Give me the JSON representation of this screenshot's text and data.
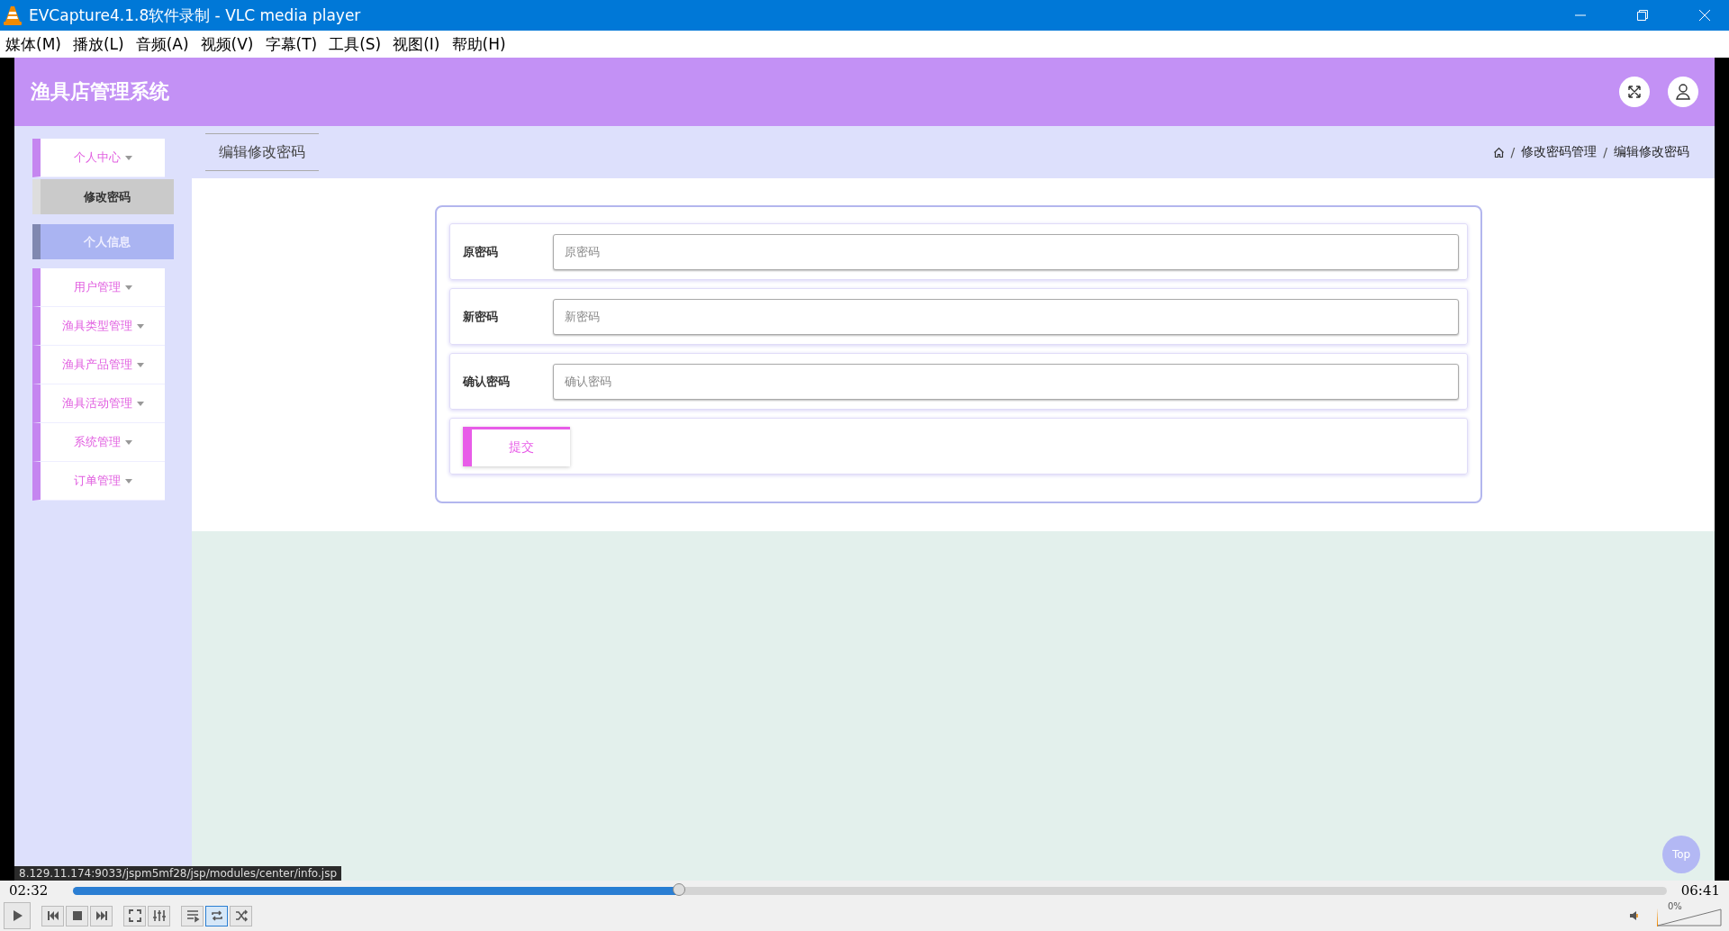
{
  "window": {
    "title": "EVCapture4.1.8软件录制 - VLC media player"
  },
  "menu": [
    "媒体(M)",
    "播放(L)",
    "音频(A)",
    "视频(V)",
    "字幕(T)",
    "工具(S)",
    "视图(I)",
    "帮助(H)"
  ],
  "app": {
    "title": "渔具店管理系统"
  },
  "sidebar": {
    "items": [
      {
        "label": "个人中心",
        "children": [
          {
            "label": "修改密码",
            "selected": true,
            "hovered": false
          },
          {
            "label": "个人信息",
            "selected": false,
            "hovered": true
          }
        ]
      },
      {
        "label": "用户管理"
      },
      {
        "label": "渔具类型管理"
      },
      {
        "label": "渔具产品管理"
      },
      {
        "label": "渔具活动管理"
      },
      {
        "label": "系统管理"
      },
      {
        "label": "订单管理"
      }
    ]
  },
  "tabs": [
    {
      "label": "编辑修改密码",
      "selected": true
    }
  ],
  "breadcrumb": [
    {
      "kind": "separator",
      "text": "/"
    },
    {
      "kind": "link",
      "text": "修改密码管理"
    },
    {
      "kind": "separator",
      "text": "/"
    },
    {
      "kind": "link",
      "text": "编辑修改密码"
    }
  ],
  "form": {
    "fields": [
      {
        "label": "原密码",
        "placeholder": "原密码"
      },
      {
        "label": "新密码",
        "placeholder": "新密码"
      },
      {
        "label": "确认密码",
        "placeholder": "确认密码"
      }
    ],
    "submit": "提交"
  },
  "scroll_top": "Top",
  "status_url": "8.129.11.174:9033/jspm5mf28/jsp/modules/center/info.jsp",
  "player": {
    "elapsed": "02:32",
    "total": "06:41",
    "seek": {
      "level": 0.38
    },
    "buttons": [
      {
        "kind": "play",
        "on": false
      },
      {
        "kind": "prev",
        "on": false
      },
      {
        "kind": "stop",
        "on": false
      },
      {
        "kind": "next",
        "on": false
      },
      {
        "kind": "fullscreen",
        "on": false
      },
      {
        "kind": "extended",
        "on": false
      },
      {
        "kind": "playlist",
        "on": false
      },
      {
        "kind": "loop",
        "on": true
      },
      {
        "kind": "random",
        "on": false
      }
    ],
    "volume": {
      "level": 0,
      "reading": "0%"
    }
  }
}
